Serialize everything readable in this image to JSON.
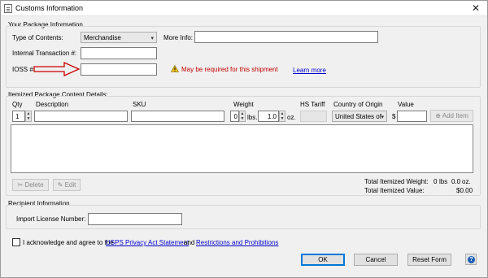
{
  "window": {
    "title": "Customs Information",
    "close_label": "✕"
  },
  "package": {
    "group_title": "Your Package Information",
    "contents_label": "Type of Contents:",
    "contents_value": "Merchandise",
    "more_info_label": "More Info:",
    "more_info_value": "",
    "internal_label": "Internal Transaction #:",
    "internal_value": "",
    "ioss_label": "IOSS #:",
    "ioss_value": "",
    "warning_text": "May be required for this shipment",
    "learn_more": "Learn more",
    "annotation_color": "#cc0000"
  },
  "items": {
    "group_title": "Itemized Package Content Details:",
    "headers": {
      "qty": "Qty",
      "description": "Description",
      "sku": "SKU",
      "weight": "Weight",
      "hs_tariff": "HS Tariff",
      "country": "Country of Origin",
      "value": "Value"
    },
    "qty_value": "1",
    "description_value": "",
    "sku_value": "",
    "lbs_value": "0",
    "lbs_unit": "lbs.",
    "oz_value": "1.0",
    "oz_unit": "oz.",
    "country_value": "United States of",
    "currency_symbol": "$",
    "value_value": "",
    "add_item": "Add Item",
    "delete": "Delete",
    "edit": "Edit",
    "total_weight_label": "Total Itemized Weight:",
    "total_weight_lbs": "0",
    "total_weight_lbs_unit": "lbs",
    "total_weight_oz": "0.0",
    "total_weight_oz_unit": "oz.",
    "total_value_label": "Total Itemized Value:",
    "total_value": "$0.00"
  },
  "recipient": {
    "group_title": "Recipient Information",
    "license_label": "Import License Number:",
    "license_value": ""
  },
  "acknowledge": {
    "prefix": "I acknowledge and agree to the",
    "link1": "USPS Privacy Act Statement",
    "middle": "and",
    "link2": "Restrictions and Prohibitions"
  },
  "footer": {
    "ok": "OK",
    "cancel": "Cancel",
    "reset": "Reset Form",
    "help_icon": "help-icon"
  }
}
